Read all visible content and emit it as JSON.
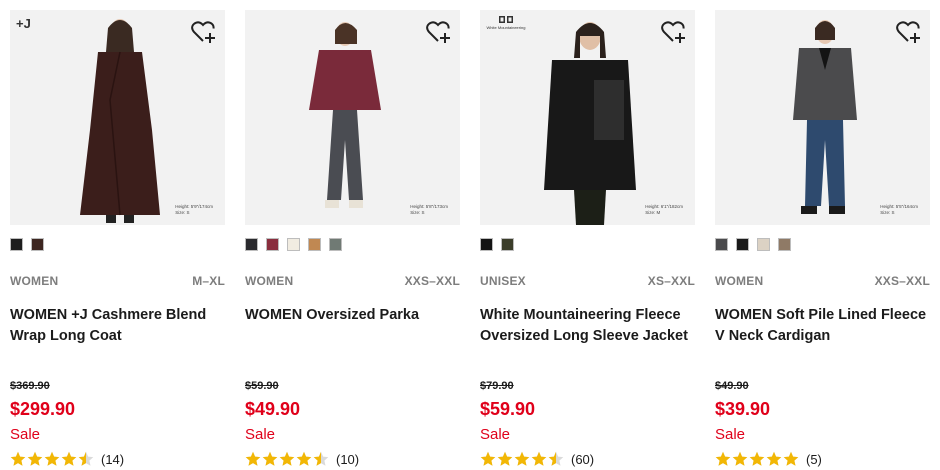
{
  "products": [
    {
      "badge": "+J",
      "badge_type": "plusj",
      "model_height": "Height: 5'9\"/174cm",
      "model_size": "Size: S",
      "colors": [
        "#1e1e1e",
        "#3d2620"
      ],
      "gender": "WOMEN",
      "size_range": "M–XL",
      "name": "WOMEN +J Cashmere Blend Wrap Long Coat",
      "original_price": "$369.90",
      "sale_price": "$299.90",
      "sale_label": "Sale",
      "rating_value": 4.5,
      "review_count": "(14)",
      "garment_color": "#3b1e1b",
      "icons": {
        "favorite": "heart-plus-icon"
      }
    },
    {
      "badge": "",
      "badge_type": "none",
      "model_height": "Height: 5'8\"/173cm",
      "model_size": "Size: S",
      "colors": [
        "#2a2a2e",
        "#8a2e3e",
        "#f1ece1",
        "#c08852",
        "#707a74"
      ],
      "gender": "WOMEN",
      "size_range": "XXS–XXL",
      "name": "WOMEN Oversized Parka",
      "original_price": "$59.90",
      "sale_price": "$49.90",
      "sale_label": "Sale",
      "rating_value": 4.5,
      "review_count": "(10)",
      "garment_color": "#7a2a3a",
      "icons": {
        "favorite": "heart-plus-icon"
      }
    },
    {
      "badge": "White Mountaineering",
      "badge_type": "wm",
      "model_height": "Height: 6'1\"/182cm",
      "model_size": "Size: M",
      "colors": [
        "#141414",
        "#3b3d2a"
      ],
      "gender": "UNISEX",
      "size_range": "XS–XXL",
      "name": "White Mountaineering Fleece Oversized Long Sleeve Jacket",
      "original_price": "$79.90",
      "sale_price": "$59.90",
      "sale_label": "Sale",
      "rating_value": 4.5,
      "review_count": "(60)",
      "garment_color": "#181818",
      "icons": {
        "favorite": "heart-plus-icon"
      }
    },
    {
      "badge": "",
      "badge_type": "none",
      "model_height": "Height: 5'5\"/164cm",
      "model_size": "Size: S",
      "colors": [
        "#4a4a4c",
        "#1a1a1a",
        "#dcd2c4",
        "#8f7a66"
      ],
      "gender": "WOMEN",
      "size_range": "XXS–XXL",
      "name": "WOMEN Soft Pile Lined Fleece V Neck Cardigan",
      "original_price": "$49.90",
      "sale_price": "$39.90",
      "sale_label": "Sale",
      "rating_value": 5,
      "review_count": "(5)",
      "garment_color": "#4b4b4d",
      "icons": {
        "favorite": "heart-plus-icon"
      }
    }
  ],
  "theme": {
    "sale_red": "#e0001a",
    "star_gold": "#f2b705",
    "muted_text": "#7d7d7d"
  }
}
